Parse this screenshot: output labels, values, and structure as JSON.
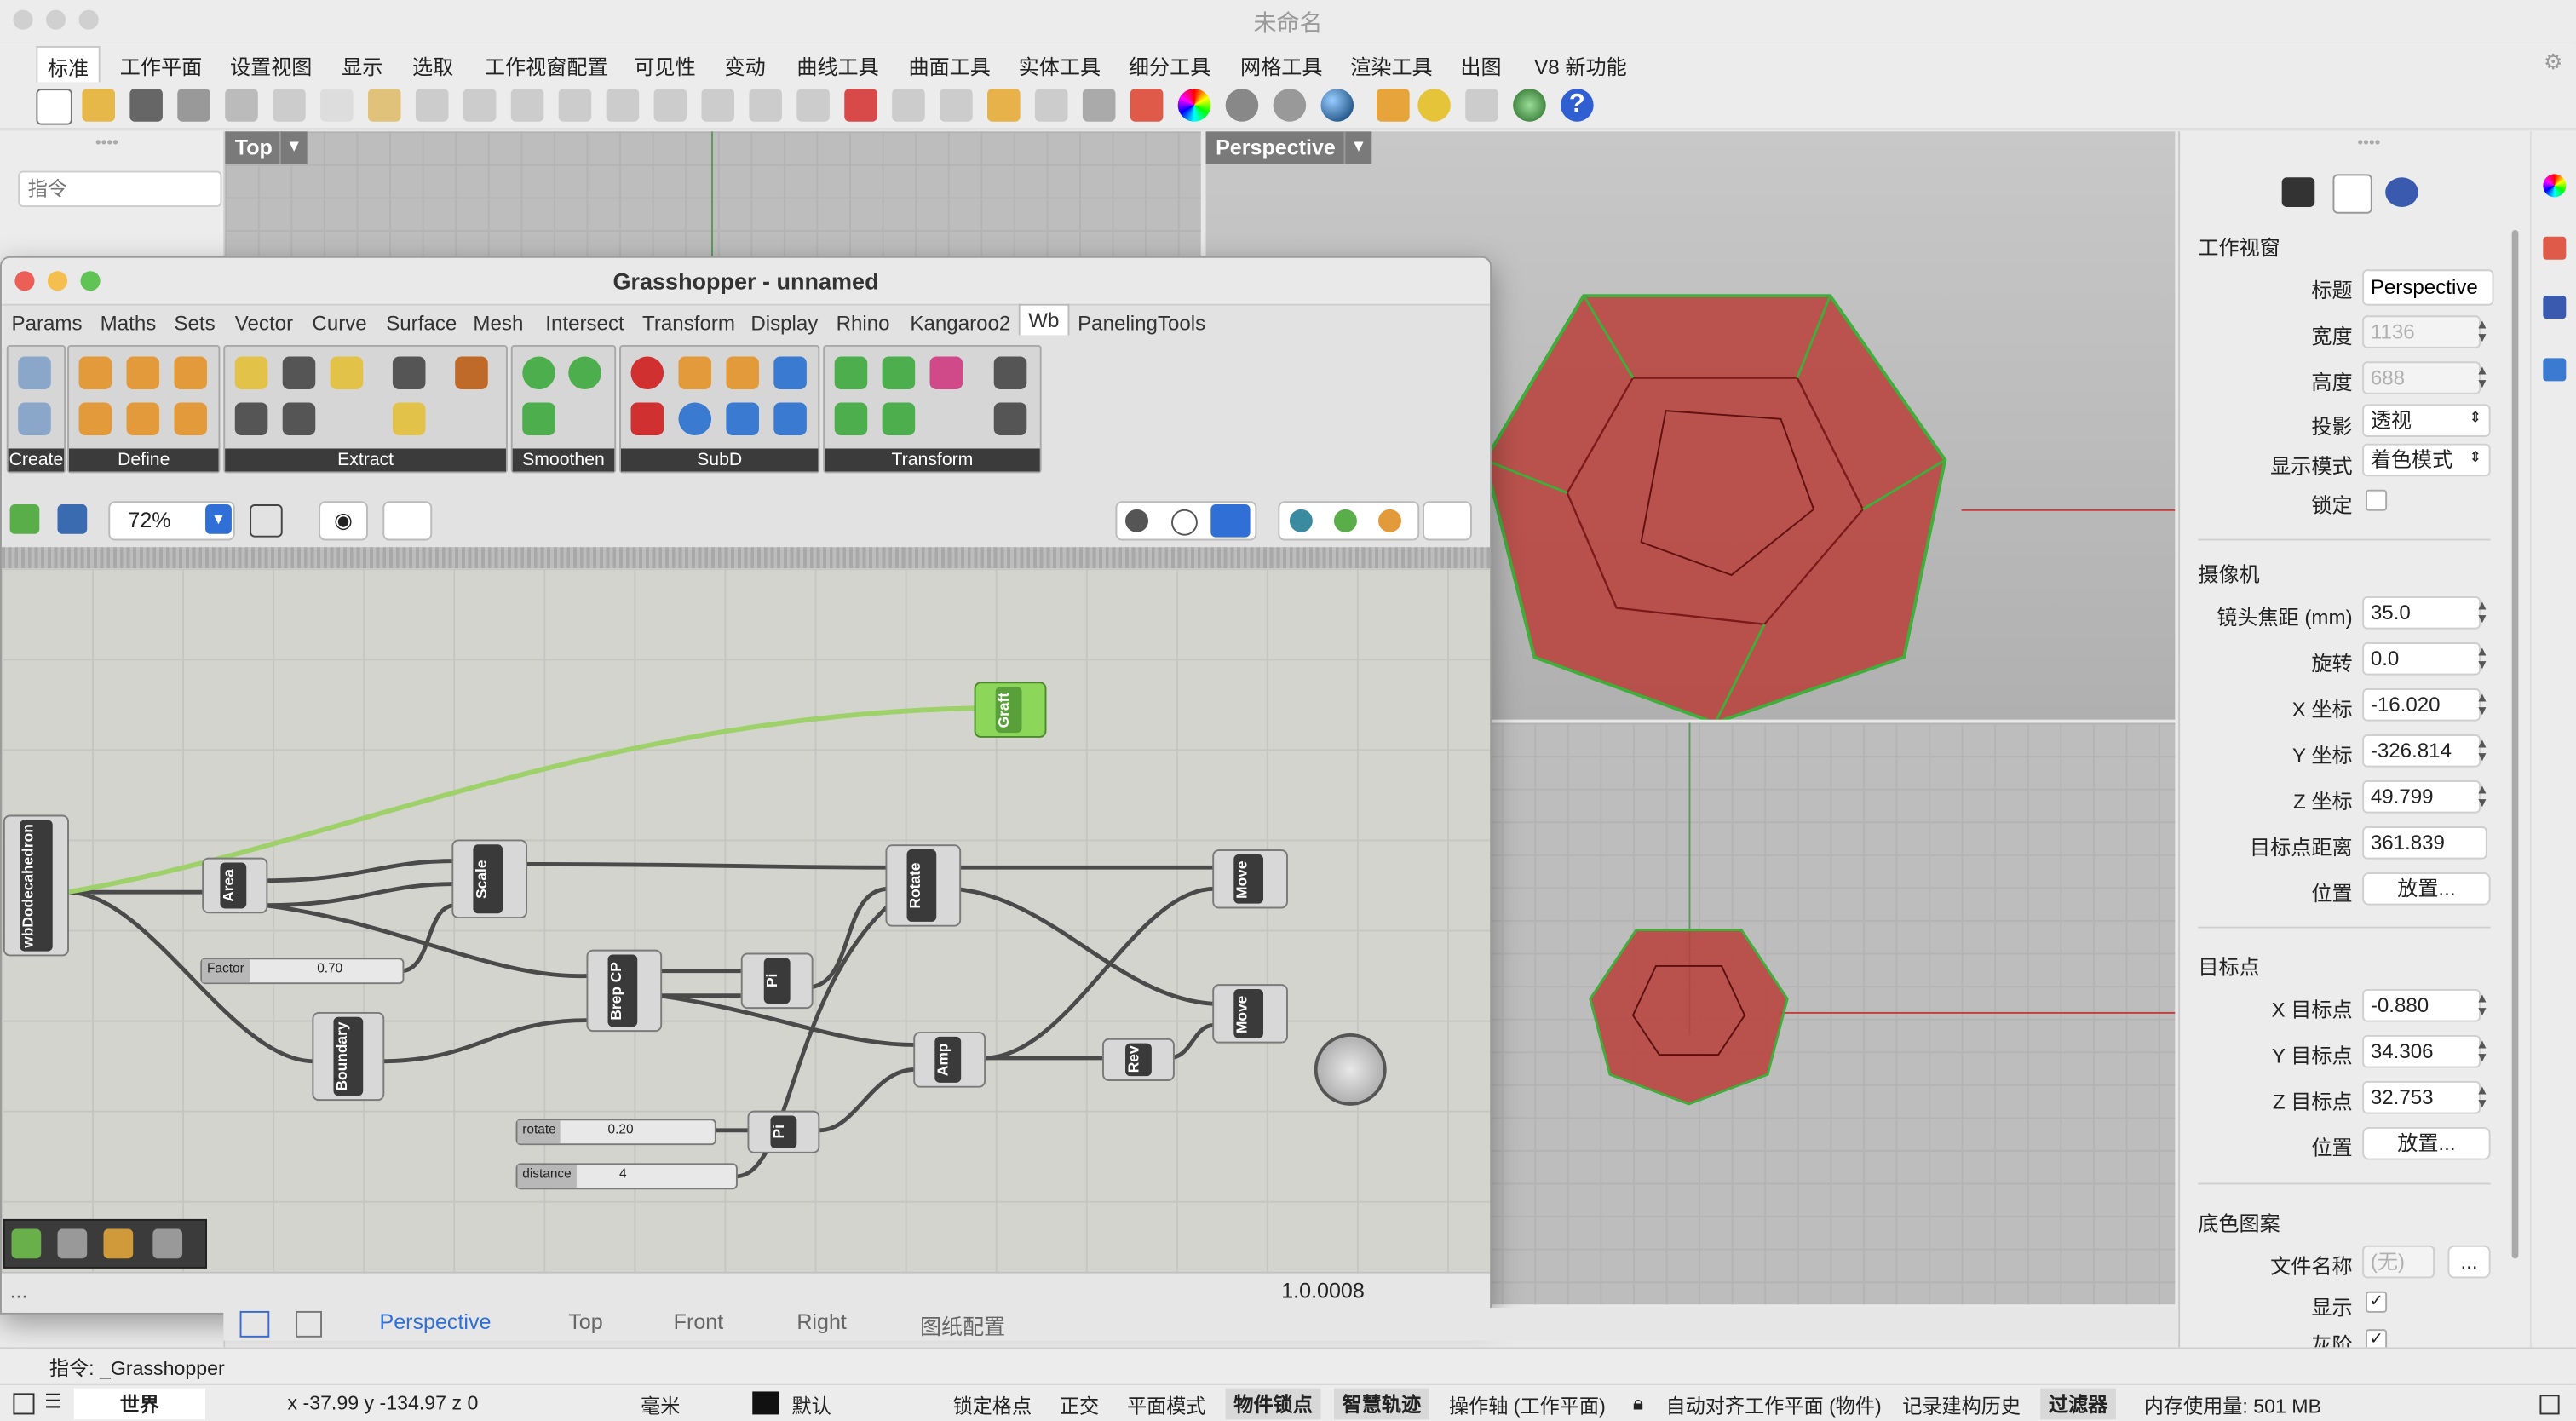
{
  "app": {
    "window_title": "未命名"
  },
  "menu": {
    "tabs": [
      "标准",
      "工作平面",
      "设置视图",
      "显示",
      "选取",
      "工作视窗配置",
      "可见性",
      "变动",
      "曲线工具",
      "曲面工具",
      "实体工具",
      "细分工具",
      "网格工具",
      "渲染工具",
      "出图",
      "V8 新功能"
    ],
    "active": "标准"
  },
  "left_panel": {
    "command_placeholder": "指令"
  },
  "viewports": {
    "top_label": "Top",
    "perspective_label": "Perspective"
  },
  "grasshopper": {
    "title": "Grasshopper - unnamed",
    "tabs": [
      "Params",
      "Maths",
      "Sets",
      "Vector",
      "Curve",
      "Surface",
      "Mesh",
      "Intersect",
      "Transform",
      "Display",
      "Rhino",
      "Kangaroo2",
      "Wb",
      "PanelingTools"
    ],
    "active_tab": "Wb",
    "groups": [
      "Create",
      "Define",
      "Extract",
      "Smoothen",
      "SubD",
      "Transform"
    ],
    "zoom": "72%",
    "version": "1.0.0008",
    "status_left": "...",
    "nodes": {
      "dodeca": "wbDodecahedron",
      "area": "Area",
      "scale": "Scale",
      "rotate": "Rotate",
      "move1": "Move",
      "move2": "Move",
      "brep_cp": "Brep CP",
      "pi1": "Pi",
      "pi2": "Pi",
      "amp": "Amp",
      "rev": "Rev",
      "boundary": "Boundary",
      "graft": "Graft"
    },
    "sliders": {
      "factor_name": "Factor",
      "factor_value": "0.70",
      "rotate_name": "rotate",
      "rotate_value": "0.20",
      "distance_name": "distance",
      "distance_value": "4"
    }
  },
  "properties": {
    "section_viewport": "工作视窗",
    "title_label": "标题",
    "title_value": "Perspective",
    "width_label": "宽度",
    "width_value": "1136",
    "height_label": "高度",
    "height_value": "688",
    "projection_label": "投影",
    "projection_value": "透视",
    "display_mode_label": "显示模式",
    "display_mode_value": "着色模式",
    "lock_label": "锁定",
    "section_camera": "摄像机",
    "focal_label": "镜头焦距 (mm)",
    "focal_value": "35.0",
    "rotation_label": "旋转",
    "rotation_value": "0.0",
    "x_label": "X 坐标",
    "x_value": "-16.020",
    "y_label": "Y 坐标",
    "y_value": "-326.814",
    "z_label": "Z 坐标",
    "z_value": "49.799",
    "target_dist_label": "目标点距离",
    "target_dist_value": "361.839",
    "position_label": "位置",
    "place_button": "放置...",
    "section_target": "目标点",
    "tx_label": "X 目标点",
    "tx_value": "-0.880",
    "ty_label": "Y 目标点",
    "ty_value": "34.306",
    "tz_label": "Z 目标点",
    "tz_value": "32.753",
    "position2_label": "位置",
    "place_button2": "放置...",
    "section_wallpaper": "底色图案",
    "filename_label": "文件名称",
    "filename_placeholder": "(无)",
    "browse_button": "...",
    "show_label": "显示",
    "gray_label": "灰阶"
  },
  "viewport_tabs": [
    "Perspective",
    "Top",
    "Front",
    "Right",
    "图纸配置"
  ],
  "active_viewport_tab": "Perspective",
  "command_line": "指令: _Grasshopper",
  "status": {
    "world": "世界",
    "coords": "x -37.99  y -134.97  z 0",
    "unit": "毫米",
    "layer": "默认",
    "grid_snap": "锁定格点",
    "ortho": "正交",
    "planar": "平面模式",
    "osnap": "物件锁点",
    "smarttrack": "智慧轨迹",
    "gumball": "操作轴 (工作平面)",
    "autoalign": "自动对齐工作平面 (物件)",
    "history": "记录建构历史",
    "filter": "过滤器",
    "memory": "内存使用量: 501 MB"
  },
  "colors": {
    "gh_ribbon_label_bg": "#3b3b3b",
    "mesh_red": "#c0392b",
    "mesh_edge_green": "#3fae3a",
    "graft_green": "#8cd65a",
    "selection_blue": "#2b6fd6"
  }
}
